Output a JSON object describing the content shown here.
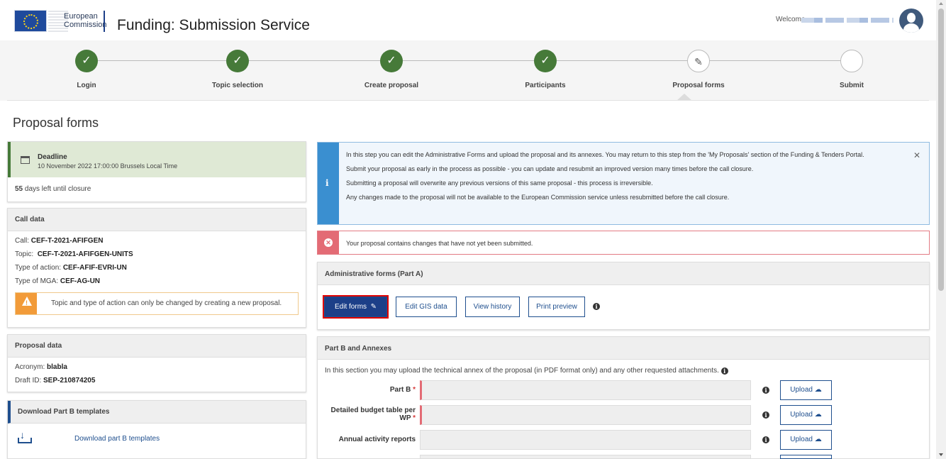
{
  "header": {
    "logo_line1": "European",
    "logo_line2": "Commission",
    "title": "Funding: Submission Service",
    "welcome": "Welcome"
  },
  "stepper": {
    "steps": [
      {
        "label": "Login",
        "state": "done"
      },
      {
        "label": "Topic selection",
        "state": "done"
      },
      {
        "label": "Create proposal",
        "state": "done"
      },
      {
        "label": "Participants",
        "state": "done"
      },
      {
        "label": "Proposal forms",
        "state": "current"
      },
      {
        "label": "Submit",
        "state": "pending"
      }
    ]
  },
  "page": {
    "title": "Proposal forms"
  },
  "deadline": {
    "title": "Deadline",
    "date": "10 November 2022 17:00:00 Brussels Local Time",
    "days_count": "55",
    "days_text": "days left until closure"
  },
  "call_data": {
    "heading": "Call data",
    "call_label": "Call:",
    "call_value": "CEF-T-2021-AFIFGEN",
    "topic_label": "Topic:",
    "topic_value": "CEF-T-2021-AFIFGEN-UNITS",
    "action_label": "Type of action:",
    "action_value": "CEF-AFIF-EVRI-UN",
    "mga_label": "Type of MGA:",
    "mga_value": "CEF-AG-UN",
    "warning": "Topic and type of action can only be changed by creating a new proposal."
  },
  "proposal_data": {
    "heading": "Proposal data",
    "acronym_label": "Acronym:",
    "acronym_value": "blabla",
    "draft_label": "Draft ID:",
    "draft_value": "SEP-210874205"
  },
  "download": {
    "heading": "Download Part B templates",
    "link": "Download part B templates"
  },
  "info": {
    "line1": "In this step you can edit the Administrative Forms and upload the proposal and its annexes. You may return to this step from the 'My Proposals' section of the Funding & Tenders Portal.",
    "line2": "Submit your proposal as early in the process as possible - you can update and resubmit an improved version many times before the call closure.",
    "line3": "Submitting a proposal will overwrite any previous versions of this same proposal - this process is irreversible.",
    "line4": "Any changes made to the proposal will not be available to the European Commission service unless resubmitted before the call closure."
  },
  "alert": {
    "text": "Your proposal contains changes that have not yet been submitted."
  },
  "admin_forms": {
    "heading": "Administrative forms (Part A)",
    "edit": "Edit forms",
    "gis": "Edit GIS data",
    "history": "View history",
    "print": "Print preview"
  },
  "part_b": {
    "heading": "Part B and Annexes",
    "intro": "In this section you may upload the technical annex of the proposal (in PDF format only) and any other requested attachments.",
    "rows": [
      {
        "label": "Part B",
        "required": true,
        "upload": "Upload"
      },
      {
        "label": "Detailed budget table per WP",
        "required": true,
        "upload": "Upload"
      },
      {
        "label": "Annual activity reports",
        "required": false,
        "upload": "Upload"
      }
    ]
  },
  "colors": {
    "accent": "#1c3f88",
    "done": "#467a39",
    "info": "#3a8fd0",
    "error": "#e36b75",
    "warning": "#f29b39"
  }
}
